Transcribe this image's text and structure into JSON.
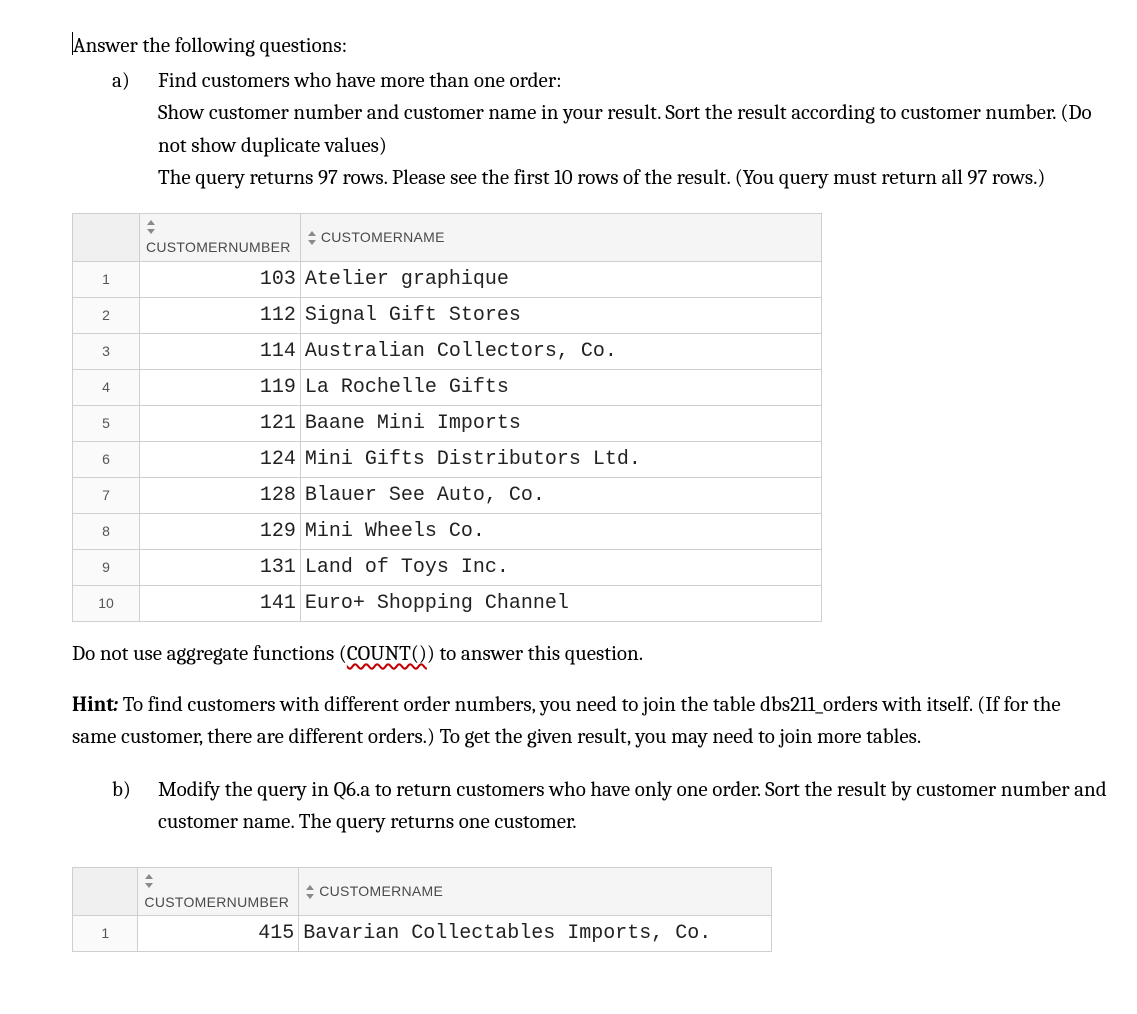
{
  "intro": "Answer the following questions:",
  "a": {
    "label": "a)",
    "line1": "Find customers who have more than one order:",
    "line2": "Show customer number and customer name in your result. Sort the result according to customer number. (Do not show duplicate values)",
    "line3": "The query returns 97 rows. Please see the first 10 rows of the result. (You query must return all 97 rows.)"
  },
  "columns": {
    "custnum": "CUSTOMERNUMBER",
    "custname": "CUSTOMERNAME"
  },
  "table_a": [
    {
      "row": "1",
      "num": "103",
      "name": "Atelier graphique"
    },
    {
      "row": "2",
      "num": "112",
      "name": "Signal Gift Stores"
    },
    {
      "row": "3",
      "num": "114",
      "name": "Australian Collectors, Co."
    },
    {
      "row": "4",
      "num": "119",
      "name": "La Rochelle Gifts"
    },
    {
      "row": "5",
      "num": "121",
      "name": "Baane Mini Imports"
    },
    {
      "row": "6",
      "num": "124",
      "name": "Mini Gifts Distributors Ltd."
    },
    {
      "row": "7",
      "num": "128",
      "name": "Blauer See Auto, Co."
    },
    {
      "row": "8",
      "num": "129",
      "name": "Mini Wheels Co."
    },
    {
      "row": "9",
      "num": "131",
      "name": "Land of Toys Inc."
    },
    {
      "row": "10",
      "num": "141",
      "name": "Euro+ Shopping Channel"
    }
  ],
  "after_a": {
    "no_agg_pre": "Do not use aggregate functions (",
    "count": "COUNT()",
    "no_agg_post": ") to answer this question.",
    "hint_label": "Hint",
    "hint_colon": ":",
    "hint_body": " To find customers with different order numbers, you need to join the table dbs211_orders with itself. (If for the same customer, there are different orders.) To get the given result, you may need to join more tables."
  },
  "b": {
    "label": "b)",
    "text": "Modify the query in Q6.a to return customers who have only one order. Sort the result by customer number and customer name. The query returns one customer."
  },
  "table_b": [
    {
      "row": "1",
      "num": "415",
      "name": "Bavarian Collectables Imports, Co."
    }
  ]
}
